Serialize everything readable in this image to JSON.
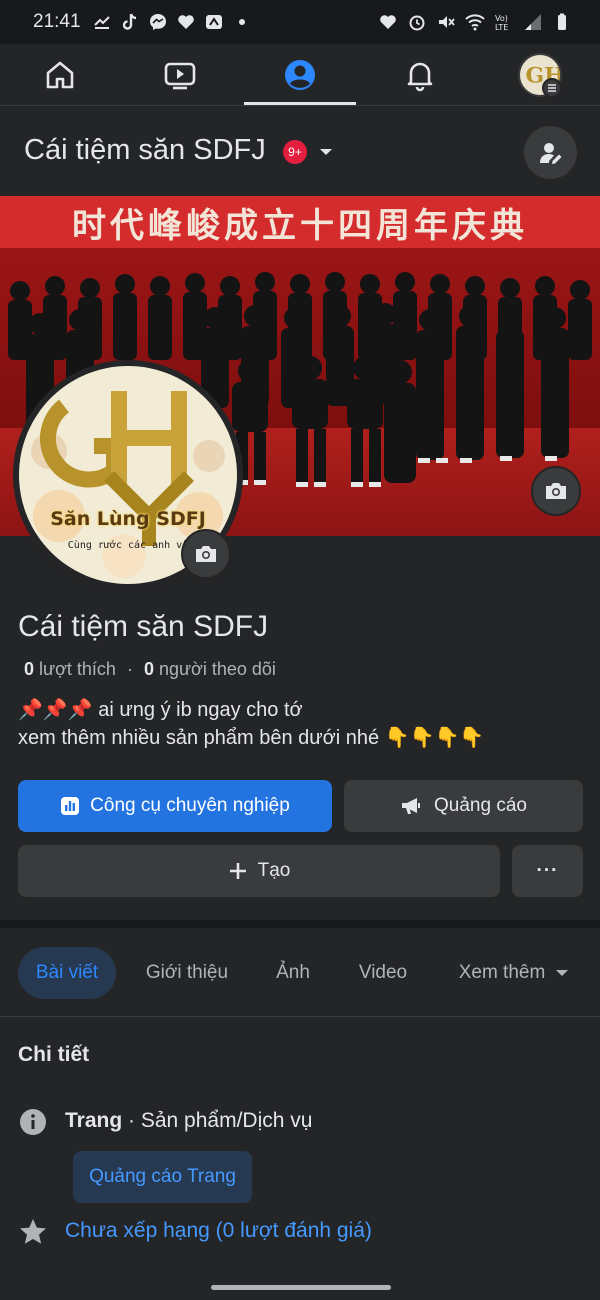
{
  "status_bar": {
    "time": "21:41"
  },
  "page_header": {
    "title": "Cái tiệm săn SDFJ",
    "notification_badge": "9+"
  },
  "cover": {
    "banner_text": "时代峰峻成立十四周年庆典"
  },
  "avatar": {
    "logo_text": "Săn Lùng SDFJ",
    "logo_subtext": "Cùng rước các anh về",
    "logo_letters": "CHY"
  },
  "profile": {
    "name": "Cái tiệm săn SDFJ",
    "likes_count": "0",
    "likes_label": "lượt thích",
    "separator": "·",
    "followers_count": "0",
    "followers_label": "người theo dõi",
    "bio_line1": "📌📌📌 ai ưng ý ib ngay cho tớ",
    "bio_line2": "xem thêm nhiều sản phẩm bên dưới nhé 👇👇👇👇"
  },
  "actions": {
    "professional_tools": "Công cụ chuyên nghiệp",
    "ads": "Quảng cáo",
    "create": "Tạo",
    "more": "···"
  },
  "tabs": [
    {
      "label": "Bài viết"
    },
    {
      "label": "Giới thiệu"
    },
    {
      "label": "Ảnh"
    },
    {
      "label": "Video"
    },
    {
      "label": "Xem thêm"
    }
  ],
  "details": {
    "title": "Chi tiết",
    "page_type_bold": "Trang",
    "page_type_rest": " · Sản phẩm/Dịch vụ",
    "promote_button": "Quảng cáo Trang",
    "rating": "Chưa xếp hạng (0 lượt đánh giá)"
  },
  "colors": {
    "accent": "#2374e1",
    "background": "#18191a",
    "surface": "#242526",
    "badge": "#e41e3f"
  }
}
